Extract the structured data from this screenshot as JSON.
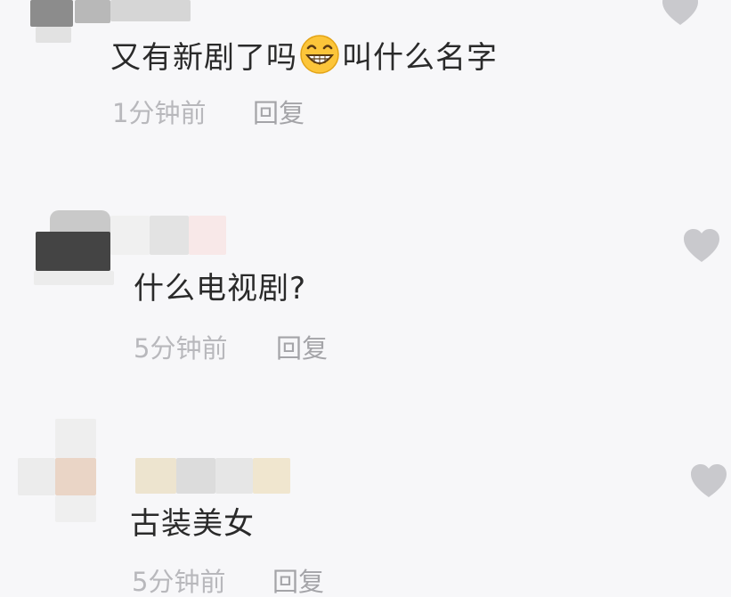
{
  "comments": [
    {
      "text_before_emoji": "又有新剧了吗",
      "emoji": "grinning-face-emoji",
      "text_after_emoji": "叫什么名字",
      "time": "1分钟前",
      "reply_label": "回复",
      "like_icon": "heart-icon"
    },
    {
      "text": "什么电视剧?",
      "time": "5分钟前",
      "reply_label": "回复",
      "like_icon": "heart-icon"
    },
    {
      "text": "古装美女",
      "time": "5分钟前",
      "reply_label": "回复",
      "like_icon": "heart-icon"
    }
  ],
  "colors": {
    "background": "#f7f7f9",
    "text": "#2a2a2a",
    "meta_text": "#b8b8bc",
    "heart": "#c9c9cd"
  }
}
